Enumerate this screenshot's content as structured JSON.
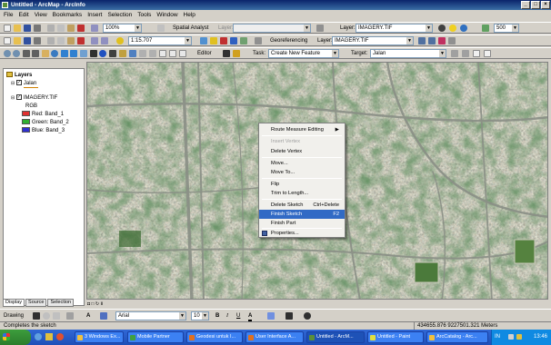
{
  "window": {
    "title": "Untitled - ArcMap - ArcInfo"
  },
  "menu": [
    "File",
    "Edit",
    "View",
    "Bookmarks",
    "Insert",
    "Selection",
    "Tools",
    "Window",
    "Help"
  ],
  "toolbar1": {
    "zoom_value": "100%",
    "spatial_analyst_label": "Spatial Analyst",
    "layer_label": "Layer:",
    "layer_value": "IMAGERY.TIF",
    "layer2_label": "Layer:",
    "layer2_value": "IMAGERY.TIF",
    "number_value": "500"
  },
  "toolbar2": {
    "scale_value": "1:15.707",
    "georef_label": "Georeferencing",
    "layer_label": "Layer:",
    "layer_value": "IMAGERY.TIF"
  },
  "toolbar3": {
    "editor_label": "Editor",
    "task_label": "Task:",
    "task_value": "Create New Feature",
    "target_label": "Target:",
    "target_value": "Jalan"
  },
  "toc": {
    "root": "Layers",
    "layer1": "Jalan",
    "layer2": "IMAGERY.TIF",
    "rgb_label": "RGB",
    "bands": [
      {
        "label": "Red:",
        "value": "Band_1",
        "color": "#e03030"
      },
      {
        "label": "Green:",
        "value": "Band_2",
        "color": "#30b030"
      },
      {
        "label": "Blue:",
        "value": "Band_3",
        "color": "#3030d0"
      }
    ],
    "tabs": [
      "Display",
      "Source",
      "Selection"
    ]
  },
  "context_menu": {
    "items": [
      {
        "label": "Route Measure Editing",
        "shortcut": "",
        "disabled": false,
        "submenu": true
      },
      {
        "label": "Insert Vertex",
        "shortcut": "",
        "disabled": true
      },
      {
        "label": "Delete Vertex",
        "shortcut": "",
        "disabled": false
      },
      {
        "label": "Move...",
        "shortcut": "",
        "disabled": false
      },
      {
        "label": "Move To...",
        "shortcut": "",
        "disabled": false
      },
      {
        "label": "Flip",
        "shortcut": "",
        "disabled": false
      },
      {
        "label": "Trim to Length...",
        "shortcut": "",
        "disabled": false
      },
      {
        "label": "Delete Sketch",
        "shortcut": "Ctrl+Delete",
        "disabled": false
      },
      {
        "label": "Finish Sketch",
        "shortcut": "F2",
        "disabled": false,
        "highlighted": true
      },
      {
        "label": "Finish Part",
        "shortcut": "",
        "disabled": false
      },
      {
        "label": "Properties...",
        "shortcut": "",
        "disabled": false
      }
    ]
  },
  "drawing": {
    "drawing_label": "Drawing",
    "font_value": "Arial",
    "size_value": "10",
    "bold": "B",
    "italic": "I",
    "underline": "U",
    "font_color": "A"
  },
  "status": {
    "message": "Completes the sketch",
    "coords": "434655.876 9227501.321 Meters"
  },
  "taskbar": {
    "start": "start",
    "tasks": [
      {
        "label": "3 Windows Ex...",
        "color": "#f0c040"
      },
      {
        "label": "Mobile Partner",
        "color": "#40a040"
      },
      {
        "label": "Geodesi untuk I...",
        "color": "#e07020"
      },
      {
        "label": "User Interface A...",
        "color": "#e07020"
      },
      {
        "label": "Untitled - ArcM...",
        "color": "#5b8f3a",
        "active": true
      },
      {
        "label": "Untitled - Paint",
        "color": "#e0e040"
      },
      {
        "label": "ArcCatalog - Arc...",
        "color": "#f0c040"
      }
    ],
    "lang": "IN",
    "time": "13:46"
  }
}
